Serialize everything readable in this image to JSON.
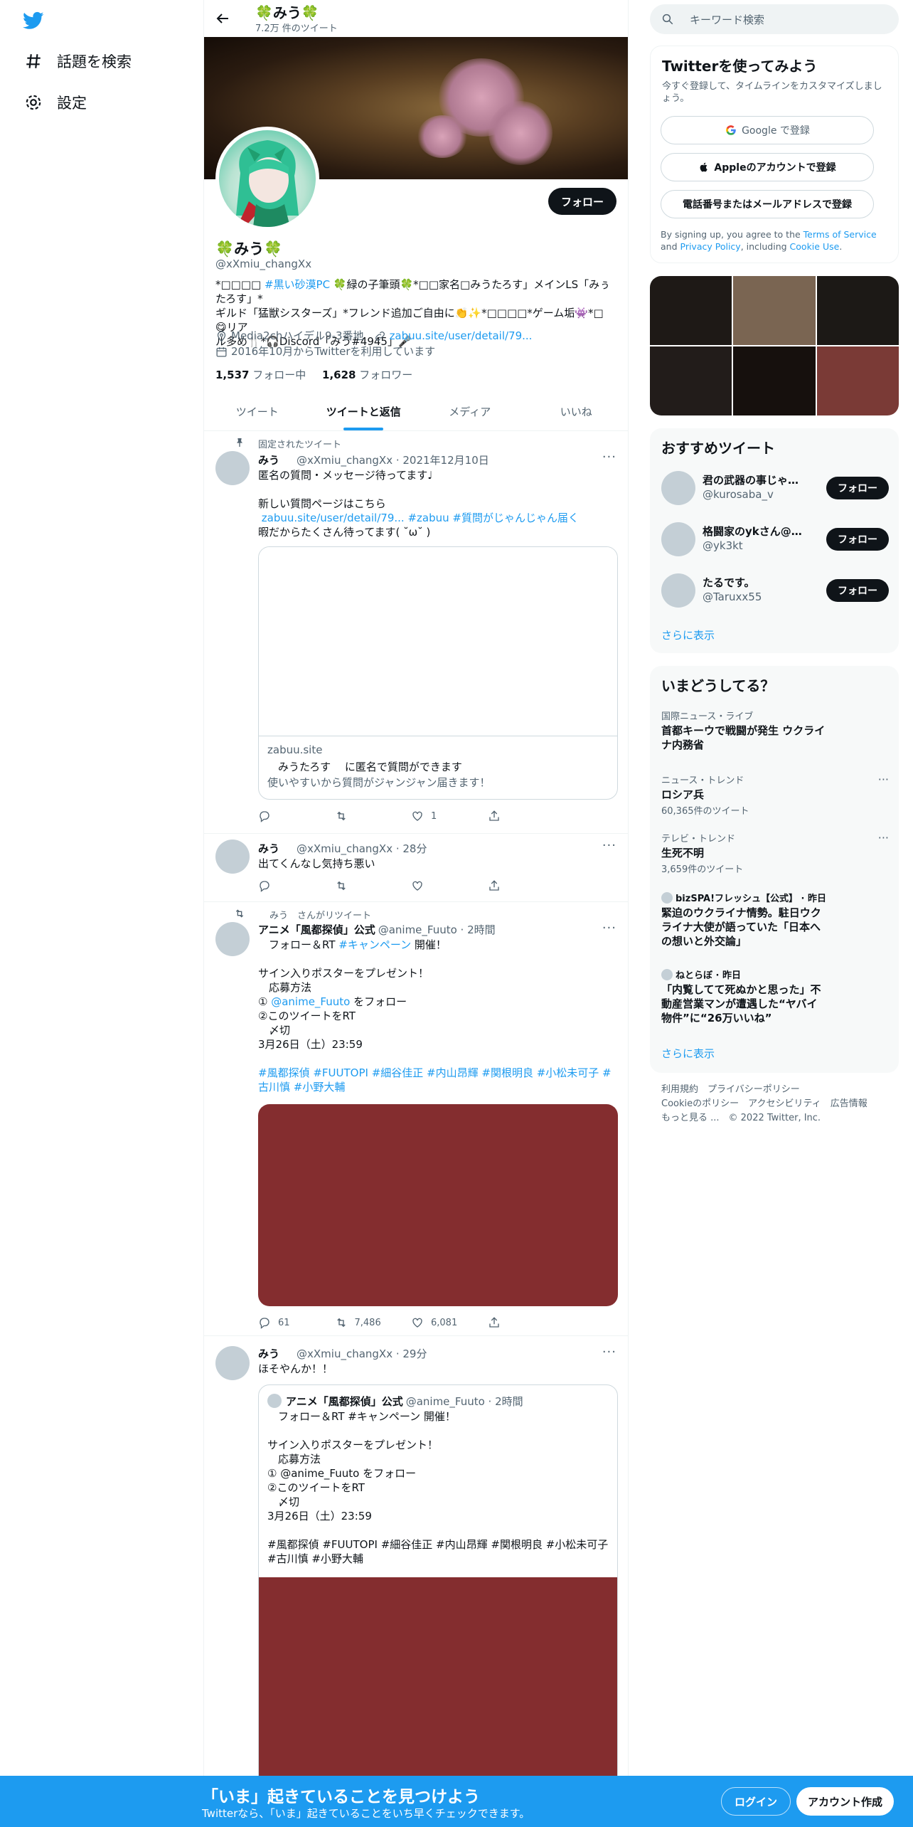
{
  "nav": {
    "explore_label": "話題を検索",
    "settings_label": "設定"
  },
  "header": {
    "name": "🍀みう🍀",
    "tweet_count": "7.2万 件のツイート"
  },
  "profile": {
    "follow_button": "フォロー",
    "name": "🍀みう🍀",
    "handle": "@xXmiu_changXx",
    "bio_line1_a": "*□□□□ ",
    "bio_line1_tag": "#黒い砂漠PC",
    "bio_line1_b": " 🍀緑の子筆頭🍀*□□家名□みうたろす」メインLS「みぅたろす」*",
    "bio_line2": "ギルド「猛獣シスターズ」*フレンド追加ご自由に👏✨*□□□□*ゲーム垢👾*□😋リア",
    "bio_line3": "ル多め🍴*🎧Discord「みう#4945」🎤",
    "location": "Media2chハイデル9-3番地",
    "url": "zabuu.site/user/detail/79...",
    "joined": "2016年10月からTwitterを利用しています",
    "following_count": "1,537",
    "following_label": " フォロー中",
    "followers_count": "1,628",
    "followers_label": " フォロワー"
  },
  "tabs": [
    "ツイート",
    "ツイートと返信",
    "メディア",
    "いいね"
  ],
  "tweets": [
    {
      "context": "固定されたツイート",
      "name": "みう",
      "handle_time": "@xXmiu_changXx · 2021年12月10日",
      "text1": "匿名の質問・メッセージ待ってます♩\n\n新しい質問ページはこちら",
      "link1": " zabuu.site/user/detail/79...",
      "tag1": " #zabuu",
      "tag2": " #質問がじゃんじゃん届く",
      "text2": "暇だからたくさん待ってます( ˘ω˘ )",
      "card_domain": "zabuu.site",
      "card_title": "　みうたろす　 に匿名で質問ができます",
      "card_desc": "使いやすいから質問がジャンジャン届きます！",
      "reply": "",
      "retweet": "",
      "like": "1"
    },
    {
      "name": "みう",
      "handle_time": "@xXmiu_changXx · 28分",
      "text": "出てくんなし気持ち悪い"
    },
    {
      "context": "みう　さんがリツイート",
      "name": "アニメ「風都探偵」公式",
      "handle_time": "@anime_Fuuto · 2時間",
      "line1_a": "　フォロー＆RT ",
      "line1_tag": "#キャンペーン",
      "line1_b": " 開催！",
      "body": "サイン入りポスターをプレゼント！\n　応募方法",
      "mention_pre": "① ",
      "mention": "@anime_Fuuto",
      "mention_post": " をフォロー",
      "body2": "②このツイートをRT\n　〆切\n3月26日（土）23:59",
      "tags": "#風都探偵 #FUUTOPI #細谷佳正 #内山昂輝 #関根明良 #小松未可子 #古川慎 #小野大輔",
      "reply": "61",
      "retweet": "7,486",
      "like": "6,081"
    },
    {
      "name": "みう",
      "handle_time": "@xXmiu_changXx · 29分",
      "text": "ほそやんか！！",
      "quote_name": "アニメ「風都探偵」公式",
      "quote_handle": "@anime_Fuuto · 2時間",
      "quote_text": "　フォロー＆RT #キャンペーン 開催！\n\nサイン入りポスターをプレゼント！\n　応募方法\n① @anime_Fuuto をフォロー\n②このツイートをRT\n　〆切\n3月26日（土）23:59\n\n#風都探偵 #FUUTOPI #細谷佳正 #内山昂輝 #関根明良 #小松未可子 #古川慎 #小野大輔"
    }
  ],
  "right": {
    "search_placeholder": "キーワード検索",
    "signup_title": "Twitterを使ってみよう",
    "signup_desc": "今すぐ登録して、タイムラインをカスタマイズしましょう。",
    "google_btn": "Google で登録",
    "apple_btn": "Appleのアカウントで登録",
    "phone_btn": "電話番号またはメールアドレスで登録",
    "terms_a": "By signing up, you agree to the ",
    "terms_link": "Terms of Service",
    "terms_b": " and ",
    "privacy_link": "Privacy Policy",
    "terms_c": ", including ",
    "cookie_link": "Cookie Use",
    "terms_d": ".",
    "recommend_title": "おすすめツイート",
    "recommend": [
      {
        "name": "君の武器の事じゃ@...",
        "handle": "@kurosaba_v",
        "btn": "フォロー"
      },
      {
        "name": "格闘家のykさん@黒...",
        "handle": "@yk3kt",
        "btn": "フォロー"
      },
      {
        "name": "たるです。",
        "handle": "@Taruxx55",
        "btn": "フォロー"
      }
    ],
    "show_more": "さらに表示",
    "trends_title": "いまどうしてる？",
    "trends": [
      {
        "cat": "国際ニュース・ライブ",
        "title": "首都キーウで戦闘が発生 ウクライナ内務省",
        "count": ""
      },
      {
        "cat": "ニュース・トレンド",
        "title": "ロシア兵",
        "count": "60,365件のツイート"
      },
      {
        "cat": "テレビ・トレンド",
        "title": "生死不明",
        "count": "3,659件のツイート"
      },
      {
        "cat": "bizSPA!フレッシュ【公式】 · 昨日",
        "title": "緊迫のウクライナ情勢。駐日ウクライナ大使が語っていた「日本への想いと外交論」",
        "count": ""
      },
      {
        "cat": "ねとらぼ · 昨日",
        "title": "「内覧してて死ぬかと思った」不動産営業マンが遭遇した“ヤバイ物件”に“26万いいね”",
        "count": ""
      }
    ],
    "trends_more": "さらに表示",
    "footer_line1": "利用規約　プライバシーポリシー",
    "footer_line2": "Cookieのポリシー　アクセシビリティ　広告情報",
    "footer_line3": "もっと見る ...　© 2022 Twitter, Inc."
  },
  "bottom": {
    "title": "「いま」起きていることを見つけよう",
    "subtitle": "Twitterなら、「いま」起きていることをいち早くチェックできます。",
    "login": "ログイン",
    "signup": "アカウント作成"
  },
  "colors": {
    "accent": "#1d9bf0",
    "media_red": "#842d2f"
  }
}
